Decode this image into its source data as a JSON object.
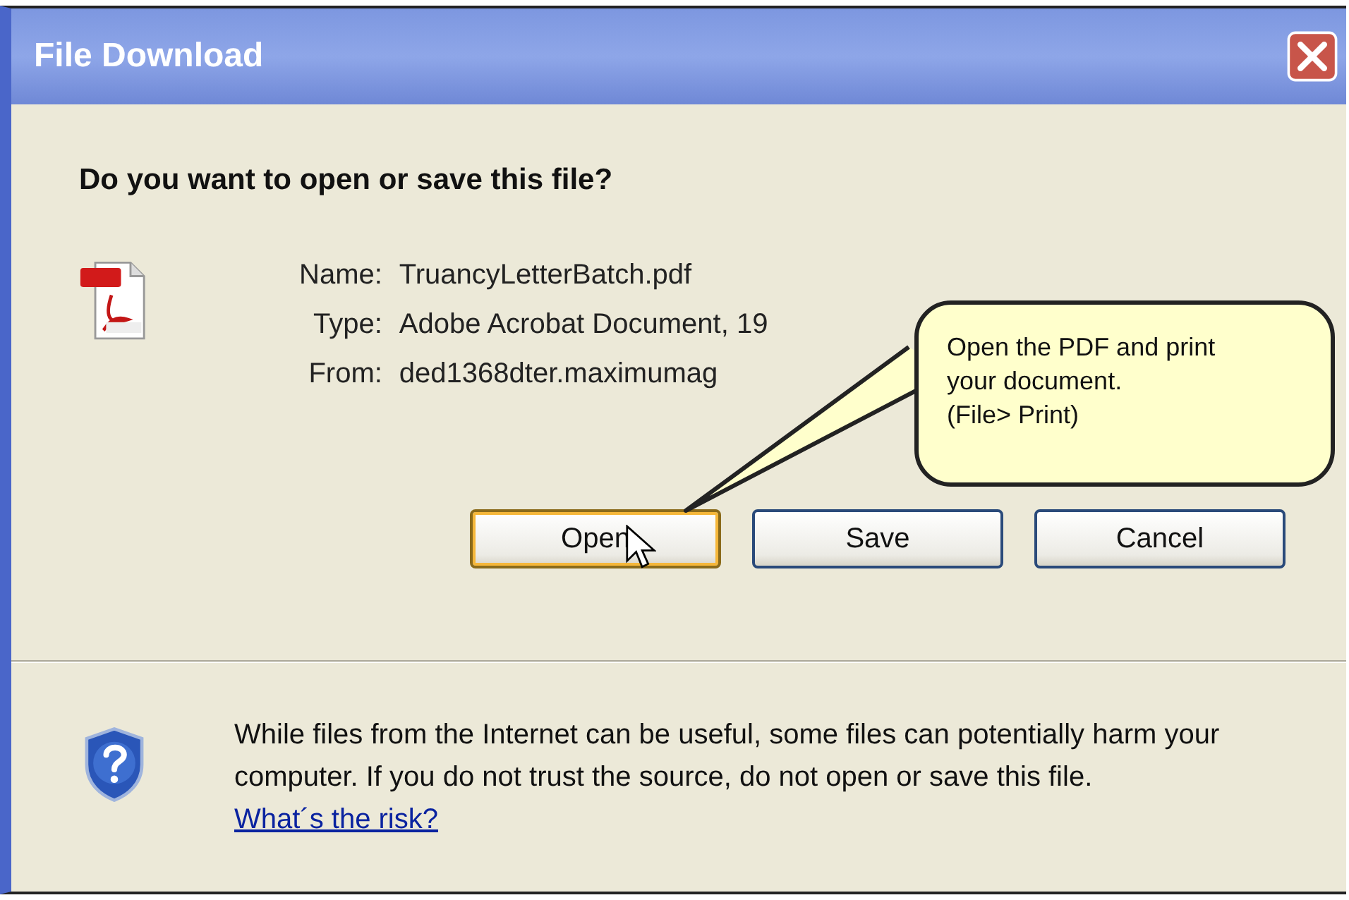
{
  "window": {
    "title": "File Download"
  },
  "heading": "Do you want to open or save this file?",
  "fields": [
    {
      "label": "Name:",
      "value": "TruancyLetterBatch.pdf"
    },
    {
      "label": "Type:",
      "value": "Adobe Acrobat Document, 19"
    },
    {
      "label": "From:",
      "value": "ded1368dter.maximumag"
    }
  ],
  "buttons": [
    {
      "label": "Open",
      "focused": true
    },
    {
      "label": "Save",
      "focused": false
    },
    {
      "label": "Cancel",
      "focused": false
    }
  ],
  "warning": {
    "text": "While files from the Internet can be useful, some files can potentially harm your computer. If you do not trust the source, do not open or save this file.",
    "link": "What´s the risk?"
  },
  "callout": {
    "lines": [
      "Open the PDF and print your document.",
      "(File> Print)"
    ]
  }
}
